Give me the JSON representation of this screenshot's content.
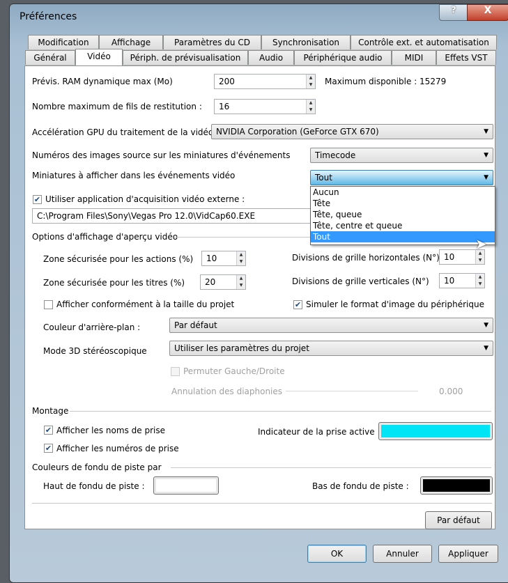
{
  "window": {
    "title": "Préférences",
    "help": "?",
    "close": "X"
  },
  "tabs_row1": [
    "Modification",
    "Affichage",
    "Paramètres du CD",
    "Synchronisation",
    "Contrôle ext. et automatisation"
  ],
  "tabs_row2": [
    "Général",
    "Vidéo",
    "Périph. de prévisualisation",
    "Audio",
    "Périphérique audio",
    "MIDI",
    "Effets VST"
  ],
  "active_tab": "Vidéo",
  "video": {
    "ram_label": "Prévis. RAM dynamique max (Mo)",
    "ram_value": "200",
    "ram_max": "Maximum disponible : 15279",
    "threads_label": "Nombre maximum de fils de restitution :",
    "threads_value": "16",
    "gpu_label": "Accélération GPU du traitement de la vidéo",
    "gpu_value": "NVIDIA Corporation (GeForce GTX 670)",
    "numbers_label": "Numéros des images source sur les miniatures d'événements",
    "numbers_value": "Timecode",
    "thumbs_label": "Miniatures à afficher dans les événements vidéo",
    "thumbs_value": "Tout",
    "thumbs_options": [
      "Aucun",
      "Tête",
      "Tête, queue",
      "Tête, centre et queue",
      "Tout"
    ],
    "capture_label": "Utiliser application d'acquisition vidéo externe :",
    "capture_path": "C:\\Program Files\\Sony\\Vegas Pro 12.0\\VidCap60.EXE",
    "preview_section": "Options d'affichage d'aperçu vidéo",
    "action_safe_label": "Zone sécurisée pour les actions (%)",
    "action_safe": "10",
    "title_safe_label": "Zone sécurisée pour les titres (%)",
    "title_safe": "20",
    "hgrid_label": "Divisions de grille horizontales (N°)",
    "hgrid": "10",
    "vgrid_label": "Divisions de grille verticales (N°)",
    "vgrid": "10",
    "project_size_label": "Afficher conformément à la taille du projet",
    "simulate_label": "Simuler le format d'image du périphérique",
    "bg_label": "Couleur d'arrière-plan :",
    "bg_value": "Par défaut",
    "stereo_label": "Mode 3D stéréoscopique",
    "stereo_value": "Utiliser les paramètres du projet",
    "swap_label": "Permuter Gauche/Droite",
    "crosstalk_label": "Annulation des diaphonies",
    "crosstalk_value": "0.000",
    "montage_section": "Montage",
    "take_names_label": "Afficher les noms de prise",
    "take_numbers_label": "Afficher les numéros de prise",
    "active_take_label": "Indicateur de la prise active",
    "active_take_color": "#00e5f5",
    "fade_section": "Couleurs de fondu de piste par",
    "fade_top_label": "Haut de fondu de piste :",
    "fade_top_color": "#ffffff",
    "fade_bottom_label": "Bas de fondu de piste :",
    "fade_bottom_color": "#000000",
    "default_button": "Par défaut"
  },
  "buttons": {
    "ok": "OK",
    "cancel": "Annuler",
    "apply": "Appliquer"
  }
}
